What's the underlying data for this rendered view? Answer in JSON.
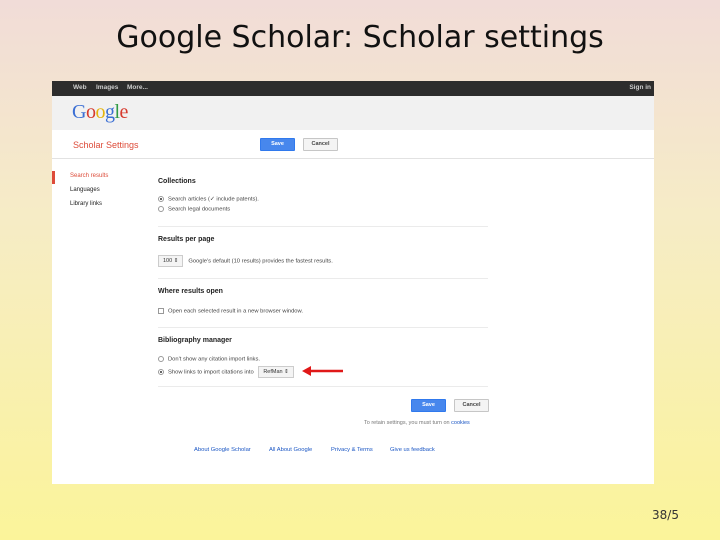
{
  "slide": {
    "title": "Google Scholar: Scholar settings",
    "page_number": "38/5"
  },
  "topbar": {
    "nav_items": [
      "Web",
      "Images",
      "More..."
    ],
    "signin_label": "Sign in"
  },
  "header": {
    "logo_letters": [
      "G",
      "o",
      "o",
      "g",
      "l",
      "e"
    ],
    "settings_title": "Scholar Settings",
    "save_label": "Save",
    "cancel_label": "Cancel"
  },
  "sidebar": {
    "items": [
      {
        "label": "Search results",
        "active": true
      },
      {
        "label": "Languages",
        "active": false
      },
      {
        "label": "Library links",
        "active": false
      }
    ]
  },
  "sections": {
    "collections": {
      "title": "Collections",
      "options": [
        {
          "label_before": "Search articles (",
          "label_check": "✓",
          "label_after": " include patents).",
          "selected": true
        },
        {
          "label": "Search legal documents",
          "selected": false
        }
      ]
    },
    "results_per_page": {
      "title": "Results per page",
      "value": "100",
      "description": "Google's default (10 results) provides the fastest results."
    },
    "where_open": {
      "title": "Where results open",
      "option": "Open each selected result in a new browser window."
    },
    "bibliography": {
      "title": "Bibliography manager",
      "options": [
        {
          "label": "Don't show any citation import links.",
          "selected": false
        },
        {
          "label": "Show links to import citations into",
          "selected": true
        }
      ],
      "manager_value": "RefMan"
    }
  },
  "bottom": {
    "save_label": "Save",
    "cancel_label": "Cancel",
    "note_prefix": "To retain settings, you must turn on ",
    "note_link": "cookies",
    "links": [
      "About Google Scholar",
      "All About Google",
      "Privacy & Terms",
      "Give us feedback"
    ]
  },
  "colors": {
    "accent_red": "#dd4b39",
    "button_blue": "#4787ed",
    "link_blue": "#1a56c4",
    "arrow_red": "#e01818"
  }
}
